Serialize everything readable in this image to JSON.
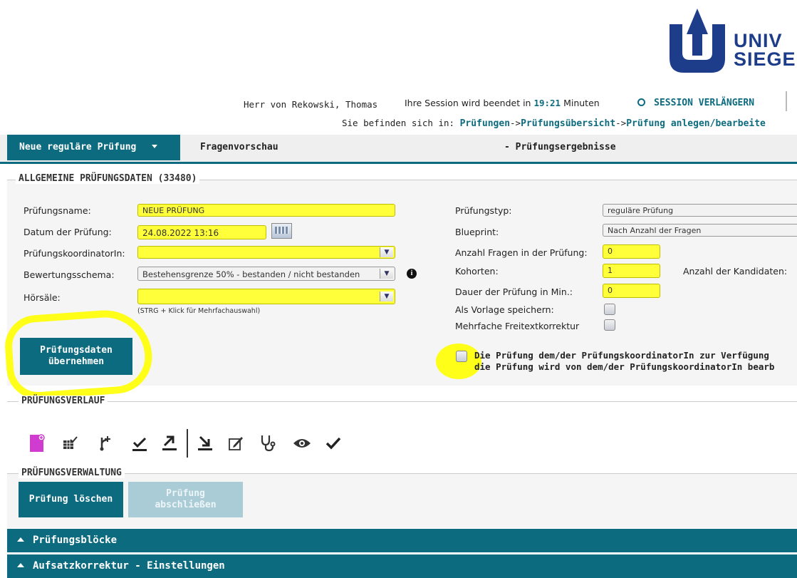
{
  "header": {
    "logo_text_line1": "UNIV",
    "logo_text_line2": "SIEGE",
    "user_name": "Herr von Rekowski, Thomas",
    "session_prefix": "Ihre Session wird beendet in",
    "session_time": "19:21",
    "session_suffix": "Minuten",
    "session_extend": "SESSION VERLÄNGERN",
    "breadcrumb_prefix": "Sie befinden sich in:",
    "breadcrumb_1": "Prüfungen",
    "breadcrumb_sep": "->",
    "breadcrumb_2": "Prüfungsübersicht",
    "breadcrumb_3": "Prüfung anlegen/bearbeite"
  },
  "tabs": {
    "tab1": "Neue reguläre Prüfung",
    "tab2": "Fragenvorschau",
    "tab3": "-  Prüfungsergebnisse"
  },
  "general": {
    "title": "ALLGEMEINE PRÜFUNGSDATEN (33480)",
    "name_label": "Prüfungsname:",
    "name_value": "NEUE PRÜFUNG",
    "date_label": "Datum der Prüfung:",
    "date_value": "24.08.2022 13:16",
    "coord_label": "PrüfungskoordinatorIn:",
    "coord_value": "",
    "schema_label": "Bewertungsschema:",
    "schema_value": "Bestehensgrenze 50% - bestanden / nicht bestanden",
    "rooms_label": "Hörsäle:",
    "rooms_value": "",
    "rooms_hint": "(STRG + Klick für Mehrfachauswahl)",
    "submit": "Prüfungsdaten übernehmen",
    "type_label": "Prüfungstyp:",
    "type_value": "reguläre Prüfung",
    "blueprint_label": "Blueprint:",
    "blueprint_value": "Nach Anzahl der Fragen",
    "qcount_label": "Anzahl Fragen in der Prüfung:",
    "qcount_value": "0",
    "cohorts_label": "Kohorten:",
    "cohorts_value": "1",
    "candidates_label": "Anzahl der Kandidaten:",
    "duration_label": "Dauer der Prüfung in Min.:",
    "duration_value": "0",
    "template_label": "Als Vorlage speichern:",
    "freetext_label": "Mehrfache Freitextkorrektur",
    "share_line1": "Die Prüfung dem/der PrüfungskoordinatorIn zur Verfügung",
    "share_line2": "die Prüfung wird von dem/der PrüfungskoordinatorIn bearb"
  },
  "progress": {
    "title": "PRÜFUNGSVERLAUF",
    "icons": [
      "new-exam-icon",
      "table-check-icon",
      "branch-icon",
      "check-line-icon",
      "upload-line-icon",
      "download-line-icon",
      "edit-icon",
      "stethoscope-icon",
      "eye-icon",
      "checkmark-icon"
    ]
  },
  "admin": {
    "title": "PRÜFUNGSVERWALTUNG",
    "delete": "Prüfung löschen",
    "close": "Prüfung abschließen"
  },
  "sections": {
    "blocks": "Prüfungsblöcke",
    "essay": "Aufsatzkorrektur - Einstellungen"
  },
  "colors": {
    "teal": "#0d6b7f",
    "highlight": "#ffff3a",
    "logo": "#1d3c8a"
  }
}
